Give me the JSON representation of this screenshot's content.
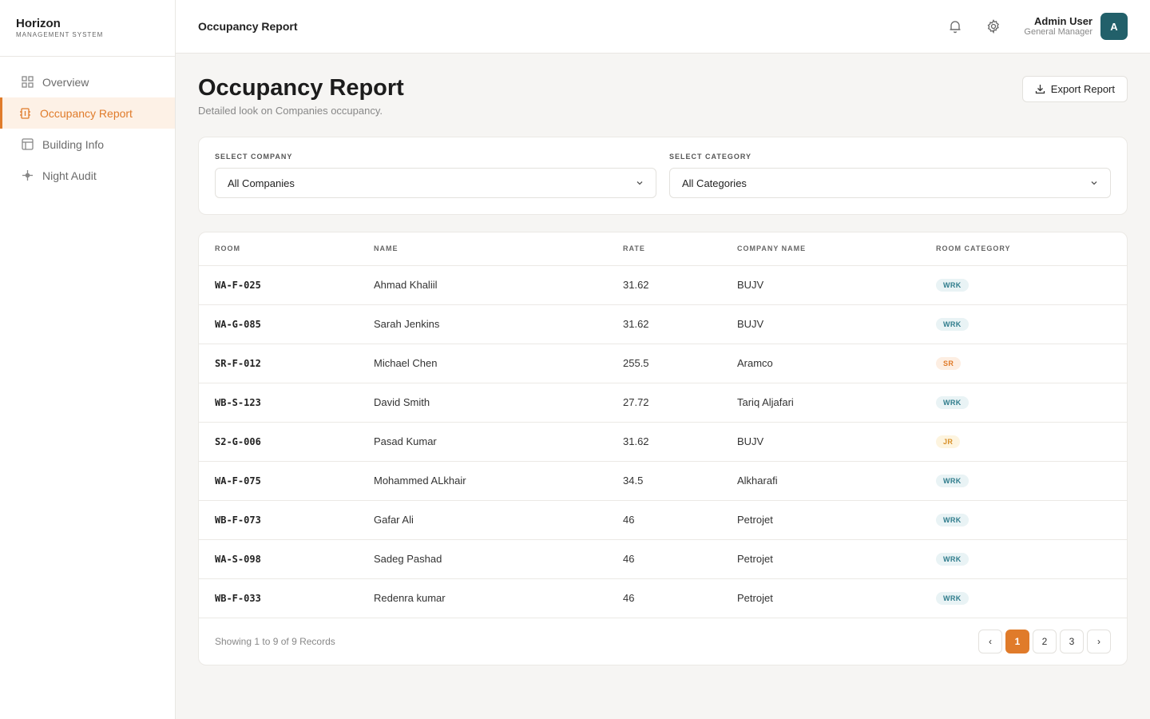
{
  "brand": {
    "name": "Horizon",
    "subtitle": "MANAGEMENT SYSTEM"
  },
  "sidebar": {
    "items": [
      {
        "label": "Overview",
        "icon": "grid-icon",
        "active": false
      },
      {
        "label": "Occupancy Report",
        "icon": "building-icon",
        "active": true
      },
      {
        "label": "Building Info",
        "icon": "layout-icon",
        "active": false
      },
      {
        "label": "Night Audit",
        "icon": "sparkle-icon",
        "active": false
      }
    ]
  },
  "header": {
    "title": "Occupancy Report",
    "user": {
      "name": "Admin User",
      "role": "General Manager",
      "initial": "A"
    }
  },
  "page": {
    "title": "Occupancy Report",
    "subtitle": "Detailed look on Companies occupancy.",
    "export_label": "Export Report"
  },
  "filters": {
    "company": {
      "label": "SELECT COMPANY",
      "value": "All Companies"
    },
    "category": {
      "label": "SELECT CATEGORY",
      "value": "All Categories"
    }
  },
  "table": {
    "columns": [
      "ROOM",
      "NAME",
      "RATE",
      "COMPANY NAME",
      "ROOM CATEGORY"
    ],
    "rows": [
      {
        "room": "WA-F-025",
        "name": "Ahmad Khaliil",
        "rate": "31.62",
        "company": "BUJV",
        "category": "WRK"
      },
      {
        "room": "WA-G-085",
        "name": "Sarah Jenkins",
        "rate": "31.62",
        "company": "BUJV",
        "category": "WRK"
      },
      {
        "room": "SR-F-012",
        "name": "Michael Chen",
        "rate": "255.5",
        "company": "Aramco",
        "category": "SR"
      },
      {
        "room": "WB-S-123",
        "name": "David Smith",
        "rate": "27.72",
        "company": "Tariq Aljafari",
        "category": "WRK"
      },
      {
        "room": "S2-G-006",
        "name": "Pasad Kumar",
        "rate": "31.62",
        "company": "BUJV",
        "category": "JR"
      },
      {
        "room": "WA-F-075",
        "name": "Mohammed ALkhair",
        "rate": "34.5",
        "company": "Alkharafi",
        "category": "WRK"
      },
      {
        "room": "WB-F-073",
        "name": "Gafar Ali",
        "rate": "46",
        "company": "Petrojet",
        "category": "WRK"
      },
      {
        "room": "WA-S-098",
        "name": "Sadeg Pashad",
        "rate": "46",
        "company": "Petrojet",
        "category": "WRK"
      },
      {
        "room": "WB-F-033",
        "name": "Redenra kumar",
        "rate": "46",
        "company": "Petrojet",
        "category": "WRK"
      }
    ],
    "footer": "Showing 1 to 9 of 9 Records"
  },
  "pagination": {
    "prev": "‹",
    "next": "›",
    "pages": [
      "1",
      "2",
      "3"
    ],
    "current": "1"
  },
  "colors": {
    "accent": "#e07b2a",
    "avatar": "#22606a",
    "wrk": "#2f7c8c",
    "sr": "#e07b2a",
    "jr": "#d9912a"
  }
}
